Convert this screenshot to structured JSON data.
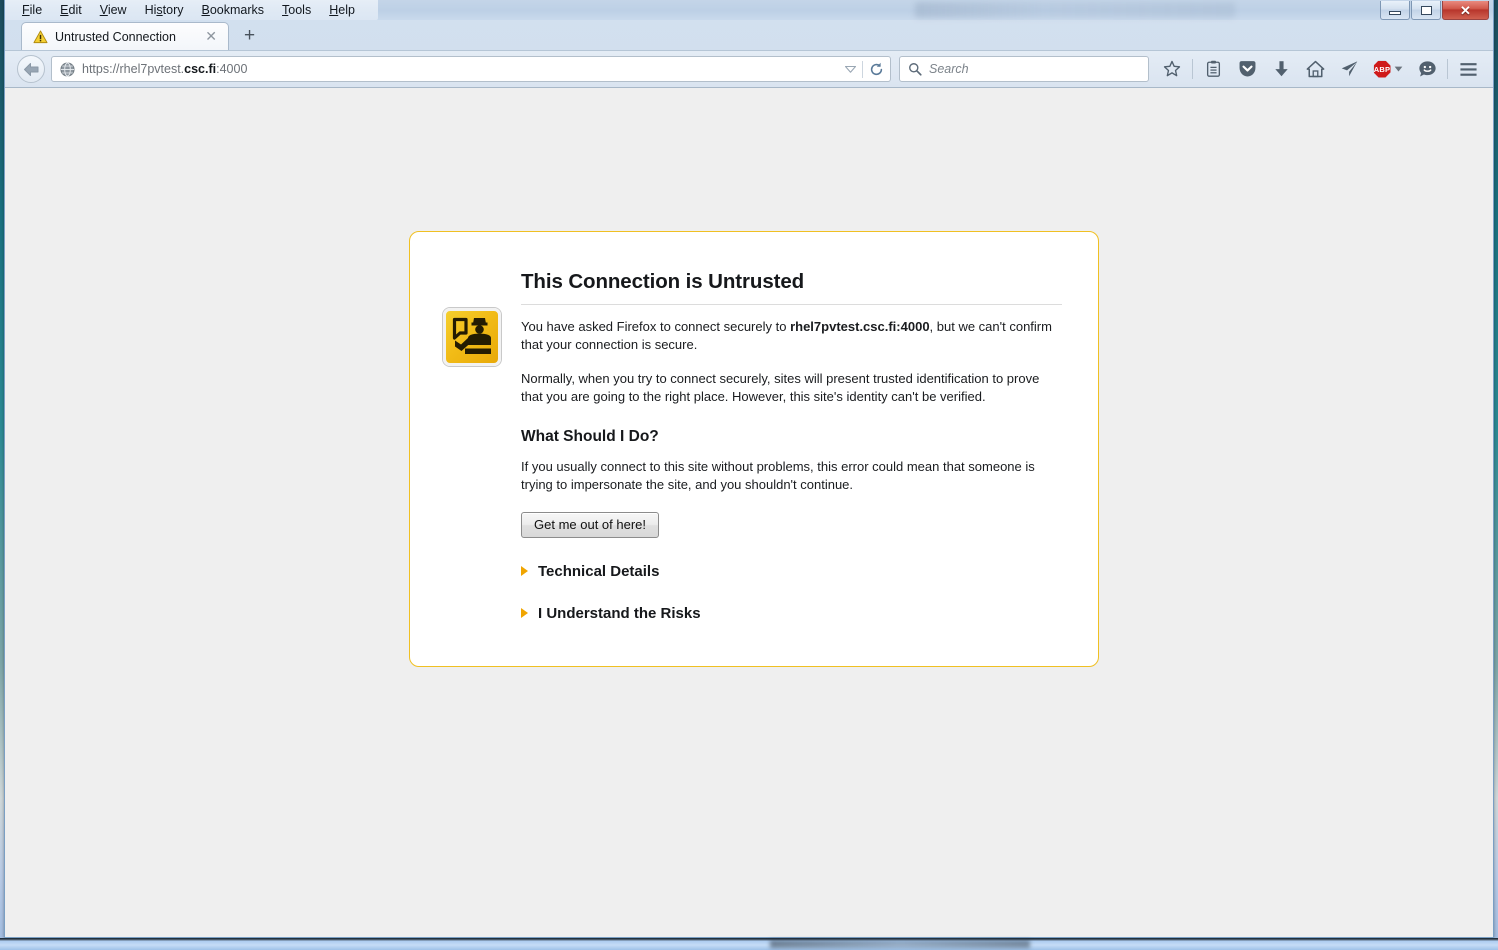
{
  "window": {
    "controls": {
      "minimize": "Minimize",
      "maximize": "Maximize",
      "close": "✕"
    }
  },
  "menubar": {
    "items": [
      {
        "label": "File",
        "accel_index": 0
      },
      {
        "label": "Edit",
        "accel_index": 0
      },
      {
        "label": "View",
        "accel_index": 0
      },
      {
        "label": "History",
        "accel_index": 2
      },
      {
        "label": "Bookmarks",
        "accel_index": 0
      },
      {
        "label": "Tools",
        "accel_index": 0
      },
      {
        "label": "Help",
        "accel_index": 0
      }
    ]
  },
  "tabstrip": {
    "active_tab": {
      "title": "Untrusted Connection",
      "icon": "warning-triangle-icon",
      "close_label": "✕"
    },
    "new_tab_label": "+"
  },
  "navbar": {
    "back_button": "back-arrow-icon",
    "url": {
      "prefix": "https://rhel7pvtest.",
      "domain": "csc.fi",
      "suffix": ":4000",
      "full": "https://rhel7pvtest.csc.fi:4000",
      "favicon": "globe-icon"
    },
    "dropdown_marker": "▼",
    "reload_label": "reload-icon",
    "search": {
      "placeholder": "Search",
      "icon": "magnifier-icon"
    },
    "icons": [
      {
        "name": "bookmark-star-icon",
        "title": "Bookmark this page"
      },
      {
        "name": "reading-list-icon",
        "title": "Show your bookmarks"
      },
      {
        "name": "pocket-icon",
        "title": "Save to Pocket"
      },
      {
        "name": "downloads-icon",
        "title": "Downloads"
      },
      {
        "name": "home-icon",
        "title": "Home"
      },
      {
        "name": "send-tab-icon",
        "title": "Send tab"
      },
      {
        "name": "adblock-plus-icon",
        "title": "Adblock Plus",
        "badge_text": "ABP"
      },
      {
        "name": "feedback-smiley-icon",
        "title": "Feedback"
      },
      {
        "name": "hamburger-menu-icon",
        "title": "Open menu"
      }
    ]
  },
  "page": {
    "icon": "passport-officer-icon",
    "title": "This Connection is Untrusted",
    "paragraph1": {
      "before": "You have asked Firefox to connect securely to ",
      "bold": "rhel7pvtest.csc.fi:4000",
      "after": ", but we can't confirm that your connection is secure."
    },
    "paragraph2": "Normally, when you try to connect securely, sites will present trusted identification to prove that you are going to the right place. However, this site's identity can't be verified.",
    "subheading": "What Should I Do?",
    "paragraph3": "If you usually connect to this site without problems, this error could mean that someone is trying to impersonate the site, and you shouldn't continue.",
    "primary_button": "Get me out of here!",
    "expanders": [
      {
        "label": "Technical Details",
        "expanded": false
      },
      {
        "label": "I Understand the Risks",
        "expanded": false
      }
    ]
  },
  "colors": {
    "accent_border": "#f0c023",
    "icon_gold": "#f2bc17",
    "expander_triangle": "#f0a500",
    "page_background": "#efefef",
    "close_button_red": "#b8362c",
    "abp_red": "#cf1a1a"
  }
}
